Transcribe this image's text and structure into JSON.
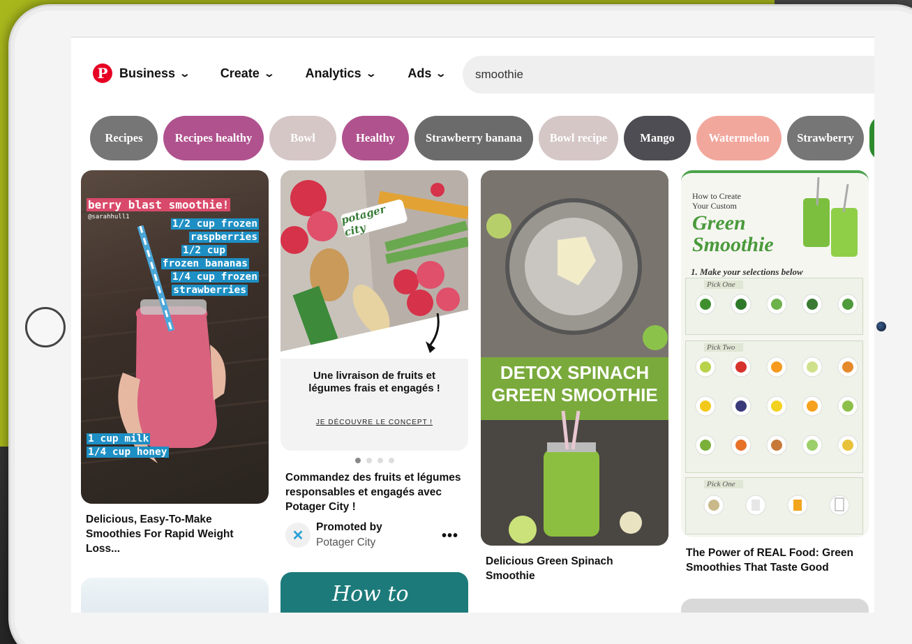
{
  "nav": {
    "logo_glyph": "P",
    "items": [
      {
        "label": "Business"
      },
      {
        "label": "Create"
      },
      {
        "label": "Analytics"
      },
      {
        "label": "Ads"
      }
    ]
  },
  "search": {
    "value": "smoothie"
  },
  "chips": [
    {
      "label": "Recipes",
      "color": "#767676"
    },
    {
      "label": "Recipes healthy",
      "color": "#b0528e"
    },
    {
      "label": "Bowl",
      "color": "#d5c7c6"
    },
    {
      "label": "Healthy",
      "color": "#b0528e"
    },
    {
      "label": "Strawberry banana",
      "color": "#6b6b6b"
    },
    {
      "label": "Bowl recipe",
      "color": "#d5c7c6"
    },
    {
      "label": "Mango",
      "color": "#4d4d53"
    },
    {
      "label": "Watermelon",
      "color": "#f2a79d"
    },
    {
      "label": "Strawberry",
      "color": "#767676"
    }
  ],
  "pins": {
    "p1": {
      "title": "Delicious, Easy-To-Make Smoothies For Rapid Weight Loss...",
      "overlay_title": "berry blast smoothie!",
      "overlay_handle": "@sarahhull1",
      "overlay_lines": [
        "1/2 cup frozen",
        "raspberries",
        "1/2 cup",
        "frozen bananas",
        "1/4 cup frozen",
        "strawberries"
      ],
      "overlay_bottom": [
        "1 cup milk",
        "1/4 cup honey"
      ]
    },
    "p2": {
      "title": "Commandez des fruits et légumes responsables et engagés avec Potager City !",
      "brand": "potager city",
      "headline": "Une livraison de fruits et légumes frais et engagés !",
      "cta": "JE DÉCOUVRE LE CONCEPT !",
      "promoted_label": "Promoted by",
      "promoter": "Potager City",
      "more": "•••"
    },
    "p3": {
      "title": "Delicious Green Spinach Smoothie",
      "banner": "DETOX SPINACH GREEN SMOOTHIE"
    },
    "p4": {
      "title": "The Power of REAL Food: Green Smoothies That Taste Good",
      "heading_small": "How to Create Your Custom",
      "heading_big": "Green Smoothie",
      "step": "1. Make your selections below",
      "section1": "Pick One",
      "section2": "Pick Two",
      "section3": "Pick One"
    },
    "p6": {
      "text": "How to"
    }
  }
}
